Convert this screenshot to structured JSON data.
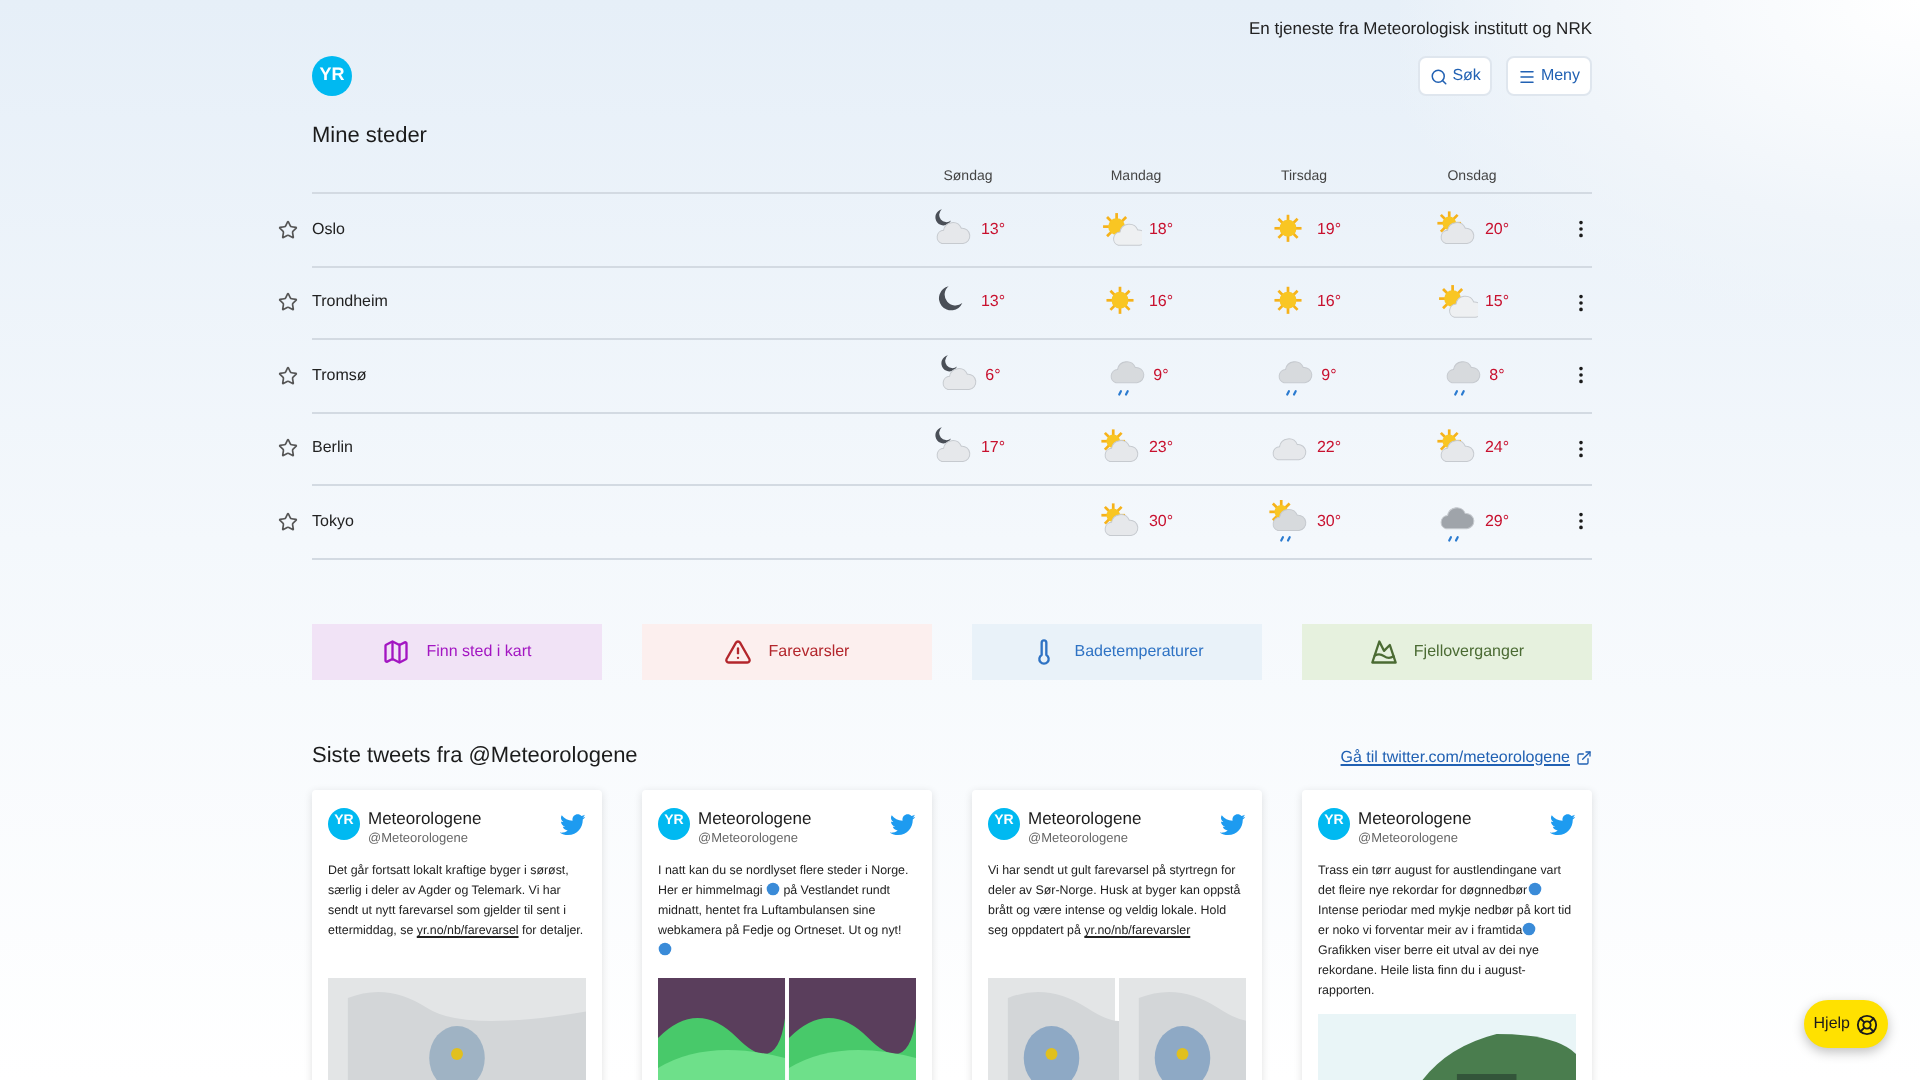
{
  "header": {
    "tagline": "En tjeneste fra Meteorologisk institutt og NRK",
    "logo": "YR",
    "search_button": "Søk",
    "menu_button": "Meny"
  },
  "places": {
    "title": "Mine steder",
    "days": [
      "Søndag",
      "Mandag",
      "Tirsdag",
      "Onsdag"
    ],
    "rows": [
      {
        "name": "Oslo",
        "starred": false,
        "forecast": [
          {
            "kind": "nightcloud",
            "temp": "13°"
          },
          {
            "kind": "suncloud",
            "temp": "18°"
          },
          {
            "kind": "sun",
            "temp": "19°"
          },
          {
            "kind": "cloudsun",
            "temp": "20°"
          }
        ]
      },
      {
        "name": "Trondheim",
        "starred": false,
        "forecast": [
          {
            "kind": "moon",
            "temp": "13°"
          },
          {
            "kind": "sun",
            "temp": "16°"
          },
          {
            "kind": "sun",
            "temp": "16°"
          },
          {
            "kind": "suncloud",
            "temp": "15°"
          }
        ]
      },
      {
        "name": "Tromsø",
        "starred": false,
        "forecast": [
          {
            "kind": "nightcloud",
            "temp": "6°"
          },
          {
            "kind": "rain",
            "temp": "9°"
          },
          {
            "kind": "rain",
            "temp": "9°"
          },
          {
            "kind": "rain",
            "temp": "8°"
          }
        ]
      },
      {
        "name": "Berlin",
        "starred": false,
        "forecast": [
          {
            "kind": "nightcloud",
            "temp": "17°"
          },
          {
            "kind": "cloudsun",
            "temp": "23°"
          },
          {
            "kind": "cloud",
            "temp": "22°"
          },
          {
            "kind": "cloudsun",
            "temp": "24°"
          }
        ]
      },
      {
        "name": "Tokyo",
        "starred": false,
        "forecast": [
          {
            "kind": "empty"
          },
          {
            "kind": "cloudsun",
            "temp": "30°"
          },
          {
            "kind": "sunrain",
            "temp": "30°"
          },
          {
            "kind": "heavyrain",
            "temp": "29°"
          }
        ]
      }
    ]
  },
  "quick_links": [
    {
      "label": "Finn sted i kart",
      "kind": "map"
    },
    {
      "label": "Farevarsler",
      "kind": "warning"
    },
    {
      "label": "Badetemperaturer",
      "kind": "thermometer"
    },
    {
      "label": "Fjelloverganger",
      "kind": "mountain"
    }
  ],
  "tweets": {
    "title": "Siste tweets fra @Meteorologene",
    "link": "Gå til twitter.com/meteorologene",
    "items": [
      {
        "author": "Meteorologene",
        "handle": "@Meteorologene",
        "avatar": "YR",
        "body": [
          {
            "kind": "text",
            "text": "Det går fortsatt lokalt kraftige byger i sørøst, særlig i deler av Agder og Telemark. Vi har sendt ut nytt farevarsel som gjelder til sent i ettermiddag, se "
          },
          {
            "kind": "link",
            "text": "yr.no/nb/farevarsel"
          },
          {
            "kind": "text",
            "text": " for detaljer."
          }
        ]
      },
      {
        "author": "Meteorologene",
        "handle": "@Meteorologene",
        "avatar": "YR",
        "body": [
          {
            "kind": "text",
            "text": "I natt kan du se nordlyset flere steder i Norge. Her er himmelmagi "
          },
          {
            "kind": "emoji"
          },
          {
            "kind": "text",
            "text": " på Vestlandet rundt midnatt, hentet fra Luftambulansen sine webkamera på Fedje og Ortneset. Ut og nyt! "
          },
          {
            "kind": "emoji"
          }
        ]
      },
      {
        "author": "Meteorologene",
        "handle": "@Meteorologene",
        "avatar": "YR",
        "body": [
          {
            "kind": "text",
            "text": "Vi har sendt ut gult farevarsel på styrtregn for deler av Sør-Norge. Husk at byger kan oppstå brått og være intense og veldig lokale. Hold seg oppdatert på "
          },
          {
            "kind": "link",
            "text": "yr.no/nb/farevarsler"
          }
        ]
      },
      {
        "author": "Meteorologene",
        "handle": "@Meteorologene",
        "avatar": "YR",
        "body": [
          {
            "kind": "text",
            "text": "Trass ein tørr august for austlendingane vart det fleire nye rekordar for døgnnedbør"
          },
          {
            "kind": "emoji"
          },
          {
            "kind": "text",
            "text": " Intense periodar med mykje nedbør på kort tid er noko vi forventar meir av i framtida"
          },
          {
            "kind": "emoji"
          },
          {
            "kind": "text",
            "text": " Grafikken viser berre eit utval av dei nye rekordane. Heile lista finn du i august-rapporten."
          }
        ]
      }
    ]
  },
  "help_button": "Hjelp"
}
